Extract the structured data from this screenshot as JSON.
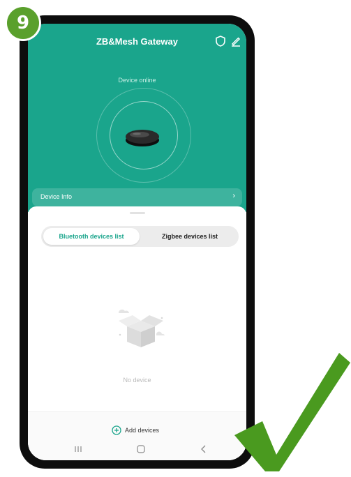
{
  "step": {
    "number": "9",
    "color": "#5aa02c"
  },
  "header": {
    "title": "ZB&Mesh Gateway",
    "status": "Device online",
    "background": "#1aa58c",
    "icons": [
      "shield-icon",
      "edit-icon"
    ]
  },
  "device_info": {
    "label": "Device Info",
    "arrow": "›"
  },
  "tabs": [
    {
      "label": "Bluetooth devices list",
      "active": true,
      "color": "#1aa58c"
    },
    {
      "label": "Zigbee devices list",
      "active": false
    }
  ],
  "empty_state": {
    "text": "No device",
    "icon": "empty-box-icon"
  },
  "actions": {
    "add_label": "Add devices",
    "icon": "plus-circle-icon"
  },
  "navbar": {
    "icons": [
      "recent-apps-icon",
      "home-icon",
      "back-icon"
    ]
  },
  "checkmark": {
    "color": "#4a9a1f",
    "icon": "checkmark-icon"
  }
}
